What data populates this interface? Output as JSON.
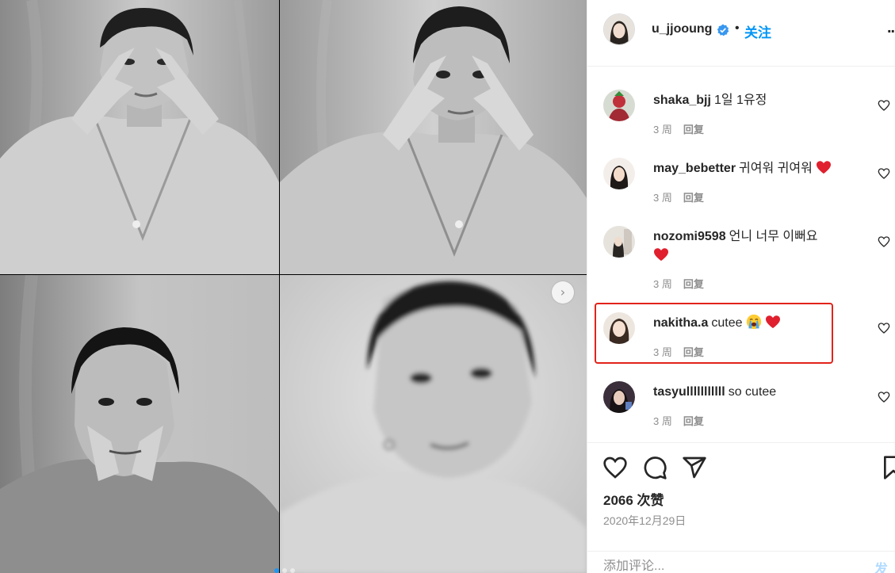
{
  "post": {
    "owner_username": "u_jjooung",
    "separator": "•",
    "follow_label": "关注",
    "more_label": "..."
  },
  "carousel": {
    "next_arrow": "›",
    "image_count": 4
  },
  "comments": [
    {
      "username": "shaka_bjj",
      "text": "1일 1유정",
      "emoji": [],
      "time": "3 周",
      "reply_label": "回复"
    },
    {
      "username": "may_bebetter",
      "text": "귀여워 귀여워",
      "emoji": [
        "red-heart"
      ],
      "time": "3 周",
      "reply_label": "回复"
    },
    {
      "username": "nozomi9598",
      "text": "언니 너무 이뻐요",
      "emoji": [
        "red-heart"
      ],
      "time": "3 周",
      "reply_label": "回复"
    },
    {
      "username": "nakitha.a",
      "text": "cutee",
      "emoji": [
        "loudly-crying-face",
        "red-heart"
      ],
      "time": "3 周",
      "reply_label": "回复"
    },
    {
      "username": "tasyulllllllllll",
      "text": "so cutee",
      "emoji": [],
      "time": "3 周",
      "reply_label": "回复"
    }
  ],
  "engagement": {
    "likes": "2066 次赞",
    "date": "2020年12月29日"
  },
  "comment_box": {
    "placeholder": "添加评论...",
    "post_label": "发布"
  },
  "colors": {
    "accent": "#0095f6",
    "highlight": "#e2231a",
    "muted": "#8e8e8e"
  }
}
